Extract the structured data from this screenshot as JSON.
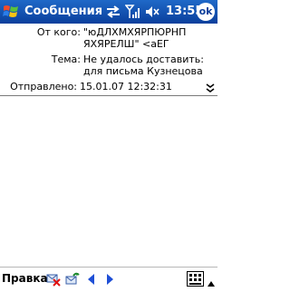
{
  "titlebar": {
    "app_title": "Сообщения",
    "clock": "13:55",
    "ok_label": "ok"
  },
  "header": {
    "from_label": "От кого:",
    "from_value": "\"юДЛХМХЯРПЮРНП ЯХЯРЕЛШ\" <аЕГ",
    "subject_label": "Тема:",
    "subject_value": "Не удалось доставить: для письма Кузнецова",
    "sent_label": "Отправлено:",
    "sent_value": "15.01.07 12:32:31"
  },
  "menubar": {
    "menu_label": "Правка"
  },
  "icons": {
    "start": "windows-flag-icon",
    "sync": "sync-arrows-icon",
    "signal": "signal-strength-icon",
    "volume": "speaker-muted-icon",
    "expand": "double-chevron-down-icon",
    "delete": "delete-message-icon",
    "reply": "reply-message-icon",
    "prev": "previous-arrow-icon",
    "next": "next-arrow-icon",
    "keyboard": "keyboard-icon"
  },
  "colors": {
    "titlebar": "#0d4fb3",
    "nav_arrow": "#1f4fd6",
    "delete_x": "#e01010"
  }
}
